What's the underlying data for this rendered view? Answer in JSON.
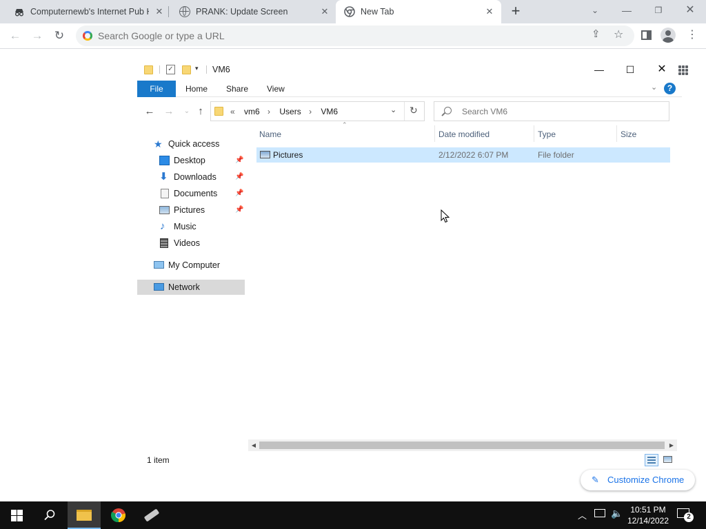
{
  "browser": {
    "tabs": [
      {
        "title": "Computernewb's Internet Pub H",
        "icon": "spy-icon",
        "active": false
      },
      {
        "title": "PRANK: Update Screen",
        "icon": "globe-icon",
        "active": false
      },
      {
        "title": "New Tab",
        "icon": "chrome-icon",
        "active": true
      }
    ],
    "new_tab_label": "+",
    "omnibox_placeholder": "Search Google or type a URL"
  },
  "explorer": {
    "title": "VM6",
    "ribbon_tabs": [
      "File",
      "Home",
      "Share",
      "View"
    ],
    "breadcrumb": [
      "vm6",
      "Users",
      "VM6"
    ],
    "breadcrumb_overflow": "«",
    "search_placeholder": "Search VM6",
    "nav": {
      "quick_access": "Quick access",
      "items": [
        {
          "label": "Desktop",
          "pinned": true,
          "icon": "desktop-icon"
        },
        {
          "label": "Downloads",
          "pinned": true,
          "icon": "downloads-icon"
        },
        {
          "label": "Documents",
          "pinned": true,
          "icon": "documents-icon"
        },
        {
          "label": "Pictures",
          "pinned": true,
          "icon": "pictures-icon"
        },
        {
          "label": "Music",
          "pinned": false,
          "icon": "music-icon"
        },
        {
          "label": "Videos",
          "pinned": false,
          "icon": "videos-icon"
        }
      ],
      "my_computer": "My Computer",
      "network": "Network"
    },
    "columns": [
      "Name",
      "Date modified",
      "Type",
      "Size"
    ],
    "rows": [
      {
        "name": "Pictures",
        "date": "2/12/2022 6:07 PM",
        "type": "File folder",
        "size": ""
      }
    ],
    "status": "1 item"
  },
  "customize_chrome": "Customize Chrome",
  "taskbar": {
    "time": "10:51 PM",
    "date": "12/14/2022",
    "notifications": "2"
  },
  "colors": {
    "accent": "#1979ca",
    "selection": "#cce8ff",
    "chrome_blue": "#1a73e8"
  }
}
